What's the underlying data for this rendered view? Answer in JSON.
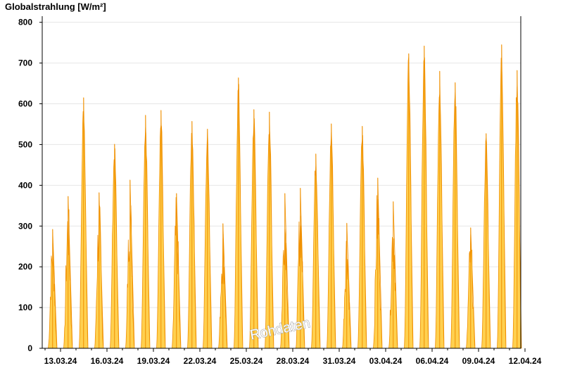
{
  "chart_data": {
    "type": "area",
    "title": "Globalstrahlung [W/m²]",
    "ylabel": "Globalstrahlung [W/m²]",
    "xlabel": "",
    "ylim": [
      0,
      815
    ],
    "y_ticks": [
      0,
      100,
      200,
      300,
      400,
      500,
      600,
      700,
      800
    ],
    "x_start": "12.03.24",
    "x_end": "13.04.24",
    "x_ticks": [
      "13.03.24",
      "16.03.24",
      "19.03.24",
      "22.03.24",
      "25.03.24",
      "28.03.24",
      "31.03.24",
      "03.04.24",
      "06.04.24",
      "09.04.24",
      "12.04.24"
    ],
    "grid": true,
    "colors": {
      "fill": "#ffd04f",
      "line": "#f09000",
      "axis": "#000000",
      "grid": "#e6e6e6"
    },
    "watermark": "Rohdaten",
    "series": [
      {
        "daily_peaks": [
          {
            "date": "12.03.24",
            "peak": 292
          },
          {
            "date": "13.03.24",
            "peak": 373
          },
          {
            "date": "14.03.24",
            "peak": 615
          },
          {
            "date": "15.03.24",
            "peak": 382
          },
          {
            "date": "16.03.24",
            "peak": 501
          },
          {
            "date": "17.03.24",
            "peak": 413
          },
          {
            "date": "18.03.24",
            "peak": 572
          },
          {
            "date": "19.03.24",
            "peak": 584
          },
          {
            "date": "20.03.24",
            "peak": 380
          },
          {
            "date": "21.03.24",
            "peak": 557
          },
          {
            "date": "22.03.24",
            "peak": 538
          },
          {
            "date": "23.03.24",
            "peak": 306
          },
          {
            "date": "24.03.24",
            "peak": 664
          },
          {
            "date": "25.03.24",
            "peak": 586
          },
          {
            "date": "26.03.24",
            "peak": 580
          },
          {
            "date": "27.03.24",
            "peak": 380
          },
          {
            "date": "28.03.24",
            "peak": 393
          },
          {
            "date": "29.03.24",
            "peak": 477
          },
          {
            "date": "30.03.24",
            "peak": 551
          },
          {
            "date": "31.03.24",
            "peak": 307
          },
          {
            "date": "01.04.24",
            "peak": 545
          },
          {
            "date": "02.04.24",
            "peak": 418
          },
          {
            "date": "03.04.24",
            "peak": 360
          },
          {
            "date": "04.04.24",
            "peak": 723
          },
          {
            "date": "05.04.24",
            "peak": 742
          },
          {
            "date": "06.04.24",
            "peak": 680
          },
          {
            "date": "07.04.24",
            "peak": 652
          },
          {
            "date": "08.04.24",
            "peak": 296
          },
          {
            "date": "09.04.24",
            "peak": 527
          },
          {
            "date": "10.04.24",
            "peak": 745
          },
          {
            "date": "11.04.24",
            "peak": 682
          }
        ]
      }
    ]
  }
}
